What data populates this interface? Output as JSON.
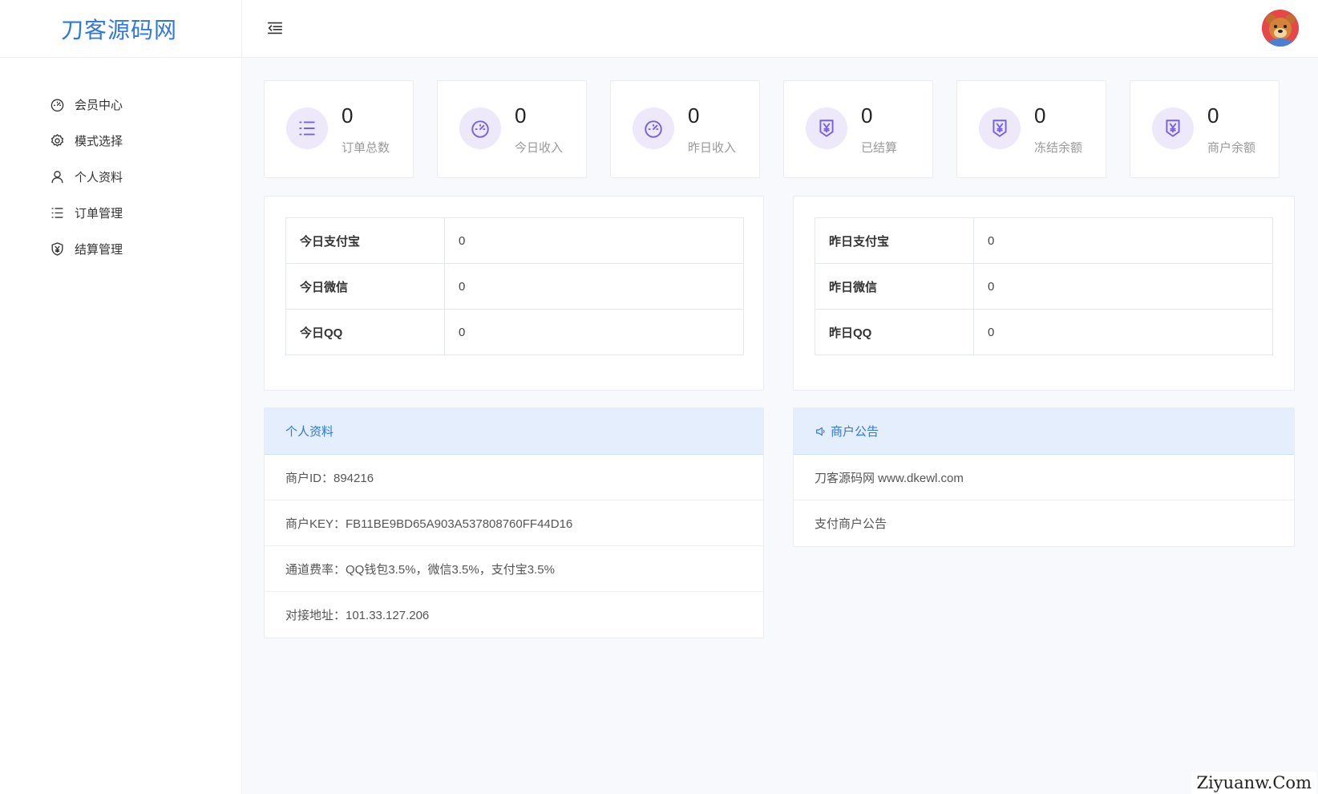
{
  "brand": {
    "title": "刀客源码网"
  },
  "sidebar": {
    "items": [
      {
        "label": "会员中心",
        "icon": "dashboard-icon"
      },
      {
        "label": "模式选择",
        "icon": "gear-icon"
      },
      {
        "label": "个人资料",
        "icon": "user-icon"
      },
      {
        "label": "订单管理",
        "icon": "list-icon"
      },
      {
        "label": "结算管理",
        "icon": "yen-shield-icon"
      }
    ]
  },
  "topbar": {
    "toggle_icon": "menu-fold-icon",
    "avatar_icon": "bear-avatar"
  },
  "stats": [
    {
      "value": "0",
      "label": "订单总数",
      "icon": "list-icon"
    },
    {
      "value": "0",
      "label": "今日收入",
      "icon": "dashboard-icon"
    },
    {
      "value": "0",
      "label": "昨日收入",
      "icon": "dashboard-icon"
    },
    {
      "value": "0",
      "label": "已结算",
      "icon": "yen-shield-icon"
    },
    {
      "value": "0",
      "label": "冻结余额",
      "icon": "yen-shield-icon"
    },
    {
      "value": "0",
      "label": "商户余额",
      "icon": "yen-shield-icon"
    }
  ],
  "today_table": [
    {
      "key": "今日支付宝",
      "value": "0"
    },
    {
      "key": "今日微信",
      "value": "0"
    },
    {
      "key": "今日QQ",
      "value": "0"
    }
  ],
  "yesterday_table": [
    {
      "key": "昨日支付宝",
      "value": "0"
    },
    {
      "key": "昨日微信",
      "value": "0"
    },
    {
      "key": "昨日QQ",
      "value": "0"
    }
  ],
  "profile_card": {
    "title": "个人资料",
    "rows": [
      "商户ID：894216",
      "商户KEY：FB11BE9BD65A903A537808760FF44D16",
      "通道费率：QQ钱包3.5%，微信3.5%，支付宝3.5%",
      "对接地址：101.33.127.206"
    ]
  },
  "notice_card": {
    "title": "商户公告",
    "icon": "speaker-icon",
    "rows": [
      "刀客源码网 www.dkewl.com",
      "支付商户公告"
    ]
  },
  "colors": {
    "accent": "#2f78e0",
    "icon_purple": "#7b61e0",
    "icon_bg": "#ede9fb",
    "header_bg": "#e4eefc"
  },
  "watermark": "Ziyuanw.Com"
}
